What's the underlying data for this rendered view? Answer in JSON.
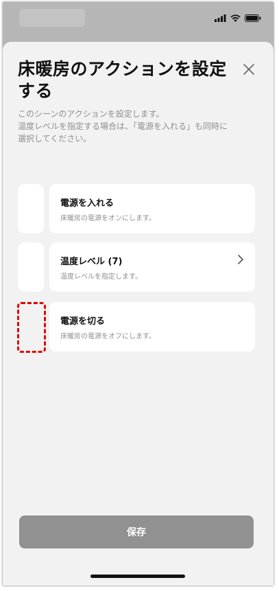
{
  "sheet": {
    "title_line1": "床暖房のアクションを設定",
    "title_line2": "する",
    "description": [
      "このシーンのアクションを設定します。",
      "温度レベルを指定する場合は、「電源を入れる」も同時に",
      "選択してください。"
    ]
  },
  "actions": [
    {
      "label": "電源を入れる",
      "sub": "床暖房の電源をオンにします。"
    },
    {
      "label": "温度レベル (7)",
      "sub": "温度レベルを指定します。"
    },
    {
      "label": "電源を切る",
      "sub": "床暖房の電源をオフにします。"
    }
  ],
  "footer": {
    "save_label": "保存"
  },
  "colors": {
    "highlight": "#e00000",
    "button": "#919191"
  },
  "icons": [
    "signal-icon",
    "wifi-icon",
    "battery-icon",
    "close-icon",
    "chevron-right-icon"
  ]
}
